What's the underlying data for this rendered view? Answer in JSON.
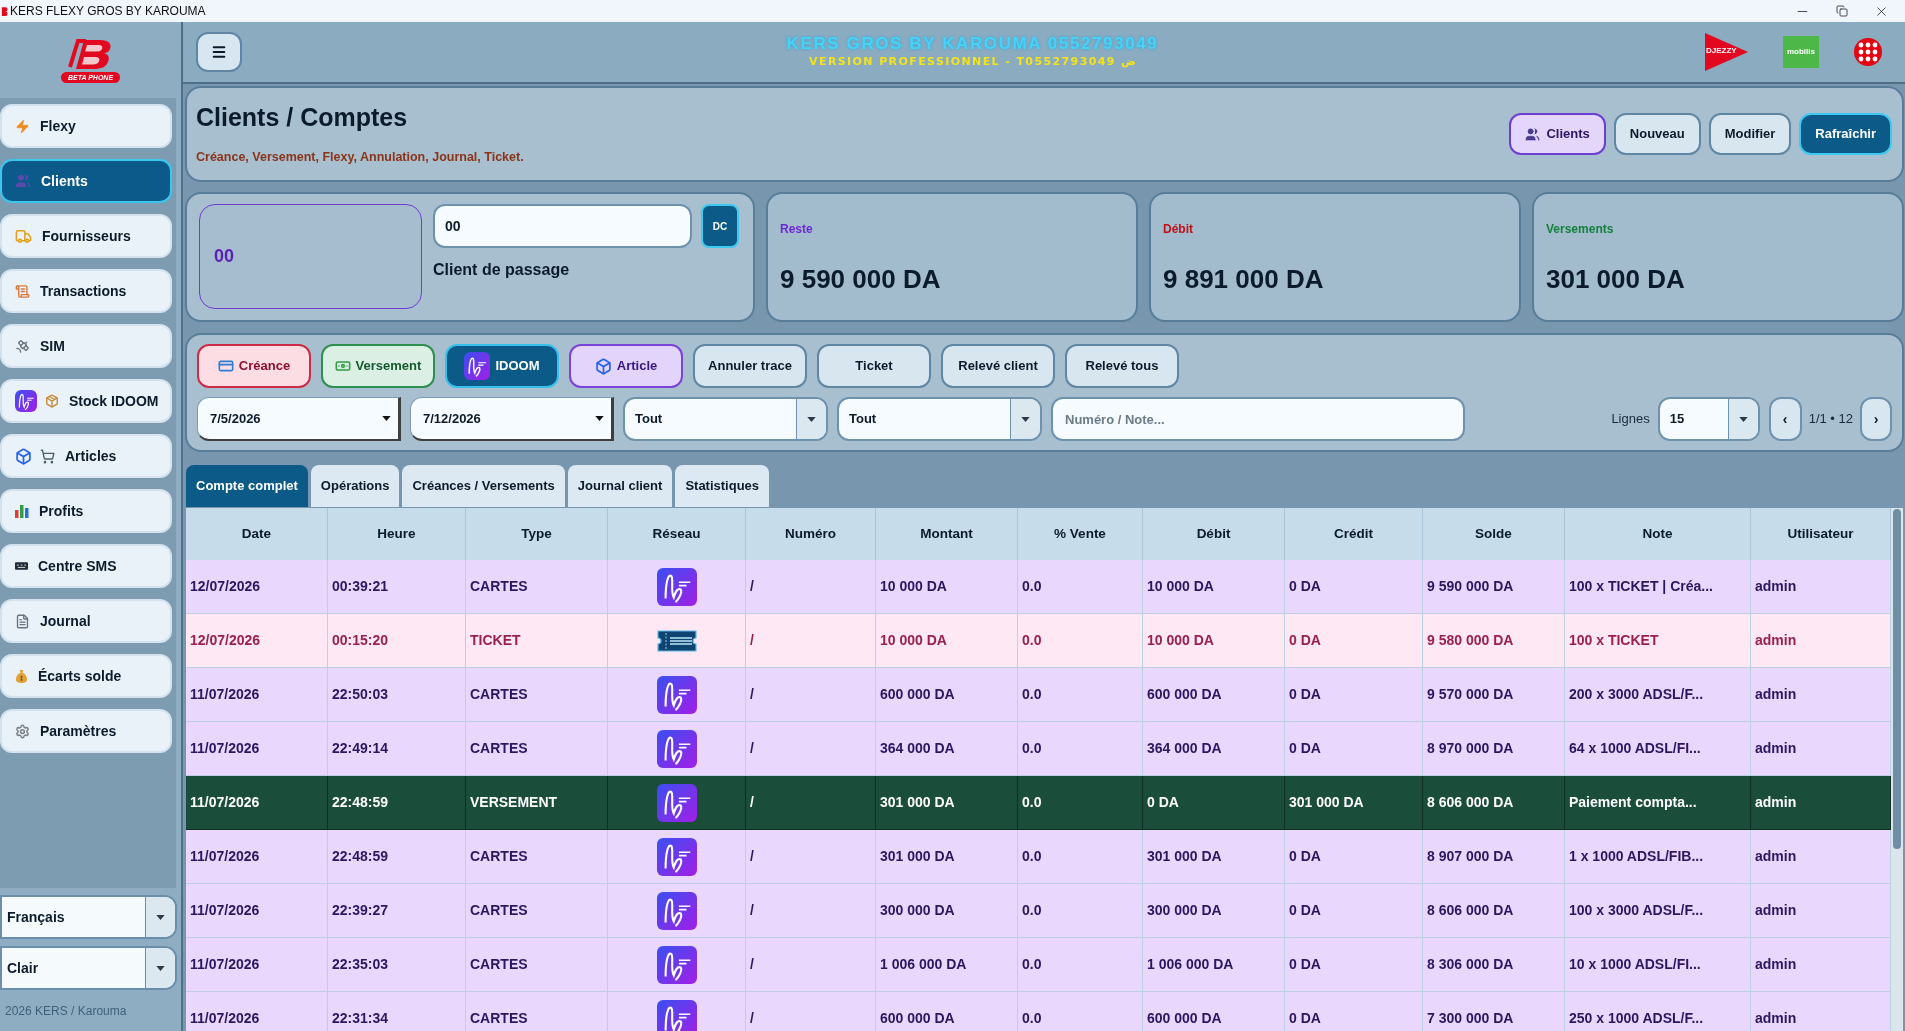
{
  "window": {
    "title": "KERS FLEXY GROS BY KAROUMA"
  },
  "sidebar": {
    "logo_text": "BETA PHONE",
    "items": [
      {
        "label": "Flexy",
        "selected": false
      },
      {
        "label": "Clients",
        "selected": true
      },
      {
        "label": "Fournisseurs",
        "selected": false
      },
      {
        "label": "Transactions",
        "selected": false
      },
      {
        "label": "SIM",
        "selected": false
      },
      {
        "label": "Stock IDOOM",
        "selected": false
      },
      {
        "label": "Articles",
        "selected": false
      },
      {
        "label": "Profits",
        "selected": false
      },
      {
        "label": "Centre SMS",
        "selected": false
      },
      {
        "label": "Journal",
        "selected": false
      },
      {
        "label": "Écarts solde",
        "selected": false
      },
      {
        "label": "Paramètres",
        "selected": false
      }
    ],
    "language": "Français",
    "theme": "Clair",
    "footer": "2026 KERS / Karouma"
  },
  "header": {
    "title": "KERS GROS BY KAROUMA 0552793049",
    "subtitle": "VERSION PROFESSIONNEL - T0552793049 ض",
    "logos": [
      {
        "kind": "triangle",
        "text": "DJEZZY"
      },
      {
        "kind": "square",
        "text": "mobilis"
      },
      {
        "kind": "dots"
      }
    ]
  },
  "page": {
    "title": "Clients / Comptes",
    "subtitle": "Créance, Versement, Flexy, Annulation, Journal, Ticket.",
    "actions": [
      {
        "label": "Clients",
        "kind": "accent"
      },
      {
        "label": "Nouveau",
        "kind": "plain"
      },
      {
        "label": "Modifier",
        "kind": "plain"
      },
      {
        "label": "Rafraîchir",
        "kind": "primary"
      }
    ]
  },
  "client": {
    "code": "00",
    "field_value": "00",
    "button": "DC",
    "name": "Client de passage"
  },
  "stats": [
    {
      "label": "Reste",
      "value": "9 590 000 DA",
      "color": "#6d28d9"
    },
    {
      "label": "Débit",
      "value": "9 891 000 DA",
      "color": "#c01018"
    },
    {
      "label": "Versements",
      "value": "301 000 DA",
      "color": "#15803d"
    }
  ],
  "operations": [
    {
      "label": "Créance",
      "kind": "creance"
    },
    {
      "label": "Versement",
      "kind": "versement"
    },
    {
      "label": "IDOOM",
      "kind": "idoom"
    },
    {
      "label": "Article",
      "kind": "article"
    },
    {
      "label": "Annuler trace",
      "kind": "plain"
    },
    {
      "label": "Ticket",
      "kind": "plain"
    },
    {
      "label": "Relevé client",
      "kind": "plain"
    },
    {
      "label": "Relevé tous",
      "kind": "plain"
    }
  ],
  "filters": [
    {
      "kind": "date",
      "value": "7/5/2026"
    },
    {
      "kind": "date",
      "value": "7/12/2026"
    },
    {
      "kind": "select",
      "value": "Tout"
    },
    {
      "kind": "select",
      "value": "Tout"
    },
    {
      "kind": "search",
      "placeholder": "Numéro / Note..."
    }
  ],
  "pagination": {
    "label": "Lignes",
    "page_size": "15",
    "prev": "‹",
    "info": "1/1 • 12",
    "next": "›"
  },
  "tabs": [
    {
      "label": "Compte complet",
      "selected": true
    },
    {
      "label": "Opérations",
      "selected": false
    },
    {
      "label": "Créances / Versements",
      "selected": false
    },
    {
      "label": "Journal client",
      "selected": false
    },
    {
      "label": "Statistiques",
      "selected": false
    }
  ],
  "table": {
    "columns": [
      "Date",
      "Heure",
      "Type",
      "Réseau",
      "Numéro",
      "Montant",
      "% Vente",
      "Débit",
      "Crédit",
      "Solde",
      "Note",
      "Utilisateur"
    ],
    "rows": [
      {
        "kind": "cartes",
        "selected": false,
        "date": "12/07/2026",
        "time": "00:39:21",
        "type": "CARTES",
        "number": "/",
        "amount": "10 000 DA",
        "sale": "0.0",
        "debit": "10 000 DA",
        "credit": "0 DA",
        "balance": "9 590 000 DA",
        "note": "100 x TICKET | Créa...",
        "user": "admin"
      },
      {
        "kind": "ticket",
        "selected": false,
        "date": "12/07/2026",
        "time": "00:15:20",
        "type": "TICKET",
        "number": "/",
        "amount": "10 000 DA",
        "sale": "0.0",
        "debit": "10 000 DA",
        "credit": "0 DA",
        "balance": "9 580 000 DA",
        "note": "100 x TICKET",
        "user": "admin"
      },
      {
        "kind": "cartes",
        "selected": false,
        "date": "11/07/2026",
        "time": "22:50:03",
        "type": "CARTES",
        "number": "/",
        "amount": "600 000 DA",
        "sale": "0.0",
        "debit": "600 000 DA",
        "credit": "0 DA",
        "balance": "9 570 000 DA",
        "note": "200 x 3000 ADSL/F...",
        "user": "admin"
      },
      {
        "kind": "cartes",
        "selected": false,
        "date": "11/07/2026",
        "time": "22:49:14",
        "type": "CARTES",
        "number": "/",
        "amount": "364 000 DA",
        "sale": "0.0",
        "debit": "364 000 DA",
        "credit": "0 DA",
        "balance": "8 970 000 DA",
        "note": "64 x 1000 ADSL/FI...",
        "user": "admin"
      },
      {
        "kind": "versement",
        "selected": true,
        "date": "11/07/2026",
        "time": "22:48:59",
        "type": "VERSEMENT",
        "number": "/",
        "amount": "301 000 DA",
        "sale": "0.0",
        "debit": "0 DA",
        "credit": "301 000 DA",
        "balance": "8 606 000 DA",
        "note": "Paiement compta...",
        "user": "admin"
      },
      {
        "kind": "cartes",
        "selected": false,
        "date": "11/07/2026",
        "time": "22:48:59",
        "type": "CARTES",
        "number": "/",
        "amount": "301 000 DA",
        "sale": "0.0",
        "debit": "301 000 DA",
        "credit": "0 DA",
        "balance": "8 907 000 DA",
        "note": "1 x 1000 ADSL/FIB...",
        "user": "admin"
      },
      {
        "kind": "cartes",
        "selected": false,
        "date": "11/07/2026",
        "time": "22:39:27",
        "type": "CARTES",
        "number": "/",
        "amount": "300 000 DA",
        "sale": "0.0",
        "debit": "300 000 DA",
        "credit": "0 DA",
        "balance": "8 606 000 DA",
        "note": "100 x 3000 ADSL/F...",
        "user": "admin"
      },
      {
        "kind": "cartes",
        "selected": false,
        "date": "11/07/2026",
        "time": "22:35:03",
        "type": "CARTES",
        "number": "/",
        "amount": "1 006 000 DA",
        "sale": "0.0",
        "debit": "1 006 000 DA",
        "credit": "0 DA",
        "balance": "8 306 000 DA",
        "note": "10 x 1000 ADSL/FI...",
        "user": "admin"
      },
      {
        "kind": "cartes",
        "selected": false,
        "date": "11/07/2026",
        "time": "22:31:34",
        "type": "CARTES",
        "number": "/",
        "amount": "600 000 DA",
        "sale": "0.0",
        "debit": "600 000 DA",
        "credit": "0 DA",
        "balance": "7 300 000 DA",
        "note": "250 x 1000 ADSL/F...",
        "user": "admin"
      }
    ]
  }
}
